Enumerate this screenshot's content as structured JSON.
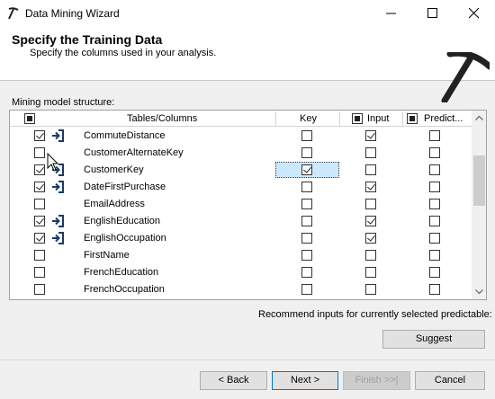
{
  "window": {
    "title": "Data Mining Wizard"
  },
  "header": {
    "title": "Specify the Training Data",
    "subtitle": "Specify the columns used in your analysis."
  },
  "structure_label": "Mining model structure:",
  "columns": {
    "tables": "Tables/Columns",
    "key": "Key",
    "input": "Input",
    "predict": "Predict..."
  },
  "header_checks": {
    "include": "partial",
    "input": "partial",
    "predict": "partial"
  },
  "rows": [
    {
      "include": true,
      "icon": "input-arrow-icon",
      "name": "CommuteDistance",
      "key": false,
      "input": true,
      "predict": false
    },
    {
      "include": false,
      "icon": "",
      "name": "CustomerAlternateKey",
      "key": false,
      "input": false,
      "predict": false
    },
    {
      "include": true,
      "icon": "input-arrow-icon",
      "name": "CustomerKey",
      "key": true,
      "input": false,
      "predict": false,
      "selected": true
    },
    {
      "include": true,
      "icon": "input-arrow-icon",
      "name": "DateFirstPurchase",
      "key": false,
      "input": true,
      "predict": false
    },
    {
      "include": false,
      "icon": "",
      "name": "EmailAddress",
      "key": false,
      "input": false,
      "predict": false
    },
    {
      "include": true,
      "icon": "input-arrow-icon",
      "name": "EnglishEducation",
      "key": false,
      "input": true,
      "predict": false
    },
    {
      "include": true,
      "icon": "input-arrow-icon",
      "name": "EnglishOccupation",
      "key": false,
      "input": true,
      "predict": false
    },
    {
      "include": false,
      "icon": "",
      "name": "FirstName",
      "key": false,
      "input": false,
      "predict": false
    },
    {
      "include": false,
      "icon": "",
      "name": "FrenchEducation",
      "key": false,
      "input": false,
      "predict": false
    },
    {
      "include": false,
      "icon": "",
      "name": "FrenchOccupation",
      "key": false,
      "input": false,
      "predict": false
    }
  ],
  "recommend_text": "Recommend inputs for currently selected predictable:",
  "buttons": {
    "suggest": "Suggest",
    "back": "< Back",
    "next": "Next >",
    "finish": "Finish >>|",
    "cancel": "Cancel"
  },
  "colors": {
    "selection": "#cce8ff",
    "accent": "#0078d7",
    "arrow_icon": "#1b3a6b"
  }
}
